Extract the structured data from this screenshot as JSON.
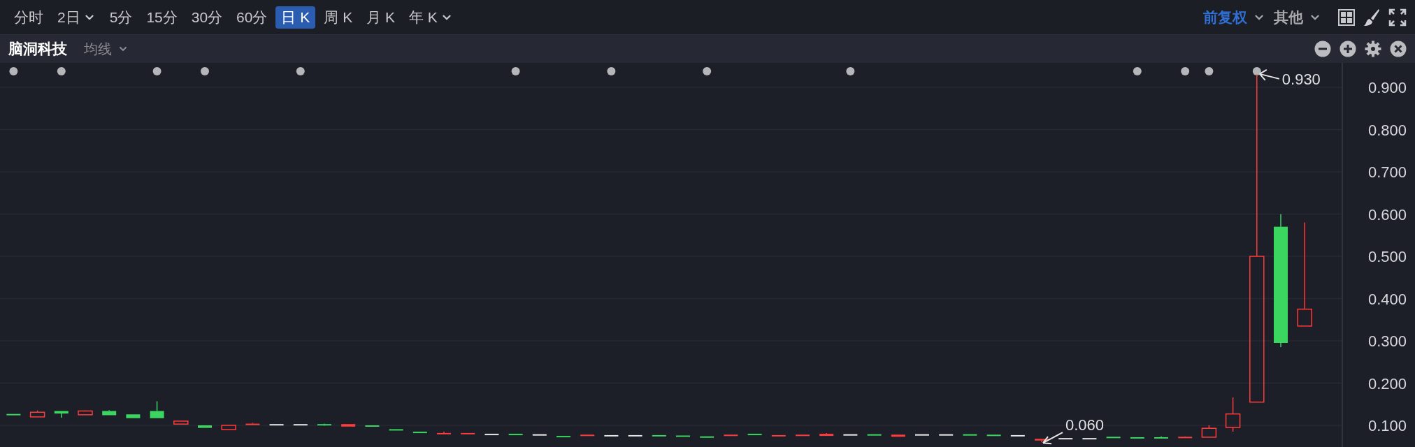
{
  "toolbar": {
    "periods": [
      {
        "label": "分时",
        "selected": false,
        "dropdown": false
      },
      {
        "label": "2日",
        "selected": false,
        "dropdown": true
      },
      {
        "label": "5分",
        "selected": false,
        "dropdown": false
      },
      {
        "label": "15分",
        "selected": false,
        "dropdown": false
      },
      {
        "label": "30分",
        "selected": false,
        "dropdown": false
      },
      {
        "label": "60分",
        "selected": false,
        "dropdown": false
      },
      {
        "label": "日 K",
        "selected": true,
        "dropdown": false
      },
      {
        "label": "周 K",
        "selected": false,
        "dropdown": false
      },
      {
        "label": "月 K",
        "selected": false,
        "dropdown": false
      },
      {
        "label": "年 K",
        "selected": false,
        "dropdown": true
      }
    ],
    "options": [
      {
        "label": "前复权",
        "active": true
      },
      {
        "label": "其他",
        "active": false
      }
    ]
  },
  "subheader": {
    "stock_name": "脑洞科技",
    "indicator": "均线"
  },
  "chart": {
    "y_ticks": [
      "0.900",
      "0.800",
      "0.700",
      "0.600",
      "0.500",
      "0.400",
      "0.300",
      "0.200",
      "0.100"
    ],
    "annotations": [
      {
        "kind": "high",
        "label": "0.930"
      },
      {
        "kind": "low",
        "label": "0.060"
      }
    ]
  }
}
